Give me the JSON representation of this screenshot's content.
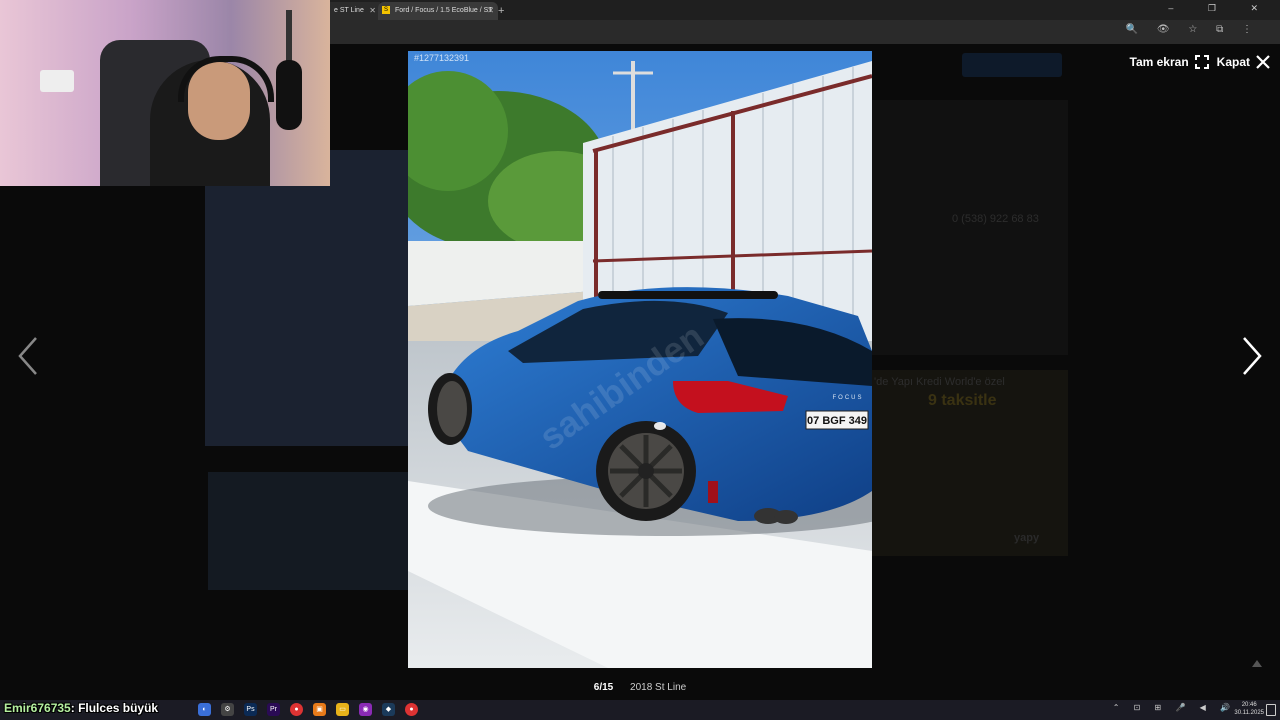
{
  "browser": {
    "tabs": [
      {
        "label": "e ST Line"
      },
      {
        "label": "Ford / Focus / 1.5 EcoBlue / ST",
        "favicon": "S"
      }
    ],
    "new_tab_label": "+",
    "window_controls": "–  ❐  ✕",
    "toolbar_icons": "🔍 👁 ☆ ⧉ ⋮"
  },
  "viewer": {
    "photo_id": "#1277132391",
    "fullscreen_label": "Tam ekran",
    "close_label": "Kapat",
    "counter": "6/15",
    "title": "2018 St Line",
    "plate_text": "07 BGF 349",
    "badge_text": "FOCUS"
  },
  "background_page": {
    "phone": "0 (538) 922 68 83",
    "ad_headline": "9 taksitle",
    "ad_brand": "yapy",
    "ad_line1": "'de Yapı Kredi World'e özel"
  },
  "stream_overlay": {
    "chat_user": "Emir676735",
    "chat_message": ": Flulces büyük"
  },
  "taskbar": {
    "time": "20:46",
    "date": "30.11.2025",
    "tray_icons": "⌃ ⊡ ⊞ 🎤 ◀ 🔊"
  }
}
